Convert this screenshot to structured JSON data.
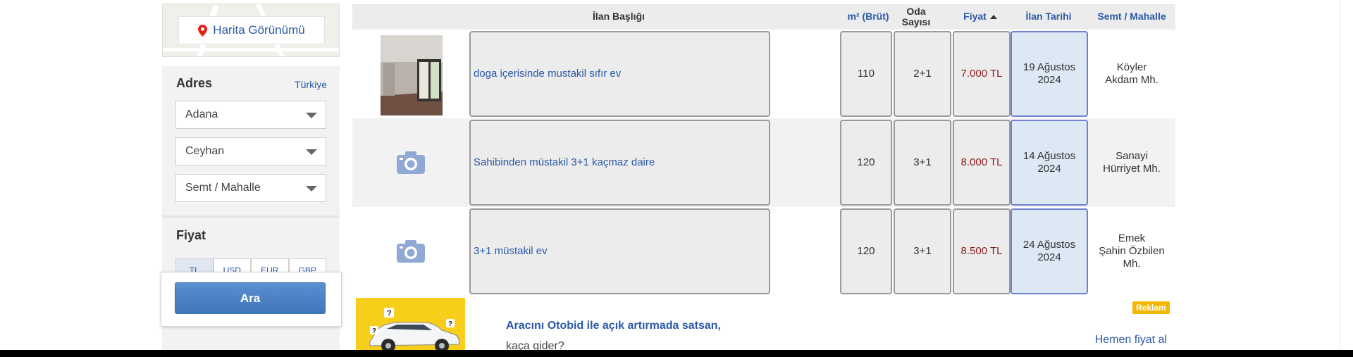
{
  "sidebar": {
    "map_button_label": "Harita Görünümü",
    "address": {
      "title": "Adres",
      "country_link": "Türkiye",
      "province": "Adana",
      "district": "Ceyhan",
      "neighborhood": "Semt / Mahalle"
    },
    "price": {
      "title": "Fiyat",
      "currencies": [
        "TL",
        "USD",
        "EUR",
        "GBP"
      ],
      "selected_currency": "TL"
    },
    "search_button_label": "Ara"
  },
  "table": {
    "headers": {
      "title": "İlan Başlığı",
      "area": "m² (Brüt)",
      "rooms": "Oda Sayısı",
      "price": "Fiyat",
      "date": "İlan Tarihi",
      "location": "Semt / Mahalle"
    },
    "sort": {
      "column": "price",
      "direction": "ascending"
    },
    "rows": [
      {
        "title": "doga içerisinde mustakil sıfır ev",
        "area": "110",
        "rooms": "2+1",
        "price": "7.000 TL",
        "date_day_month": "19 Ağustos",
        "date_year": "2024",
        "loc_line1": "Köyler",
        "loc_line2": "Akdam Mh.",
        "loc_line3": "",
        "has_photo": true
      },
      {
        "title": "Sahibinden müstakil 3+1 kaçmaz daire",
        "area": "120",
        "rooms": "3+1",
        "price": "8.000 TL",
        "date_day_month": "14 Ağustos",
        "date_year": "2024",
        "loc_line1": "Sanayi",
        "loc_line2": "Hürriyet Mh.",
        "loc_line3": "",
        "has_photo": false
      },
      {
        "title": "3+1 müstakil ev",
        "area": "120",
        "rooms": "3+1",
        "price": "8.500 TL",
        "date_day_month": "24 Ağustos",
        "date_year": "2024",
        "loc_line1": "Emek",
        "loc_line2": "Şahin Özbilen",
        "loc_line3": "Mh.",
        "has_photo": false
      }
    ]
  },
  "ad": {
    "title": "Aracını Otobid ile açık artırmada satsan,",
    "subtitle": "kaça gider?",
    "badge": "Reklam",
    "cta": "Hemen fiyat al"
  },
  "icons": {
    "map_pin": "map-pin-icon",
    "dropdown": "chevron-down-icon",
    "no_photo": "camera-icon",
    "sort": "sort-up-icon"
  },
  "colors": {
    "link_blue": "#2a59a6",
    "price_red": "#8b1a1a",
    "date_highlight": "#dce8f3",
    "search_button": "#4a80c4",
    "ad_badge": "#f2b705",
    "ad_yellow": "#f7cf1a"
  }
}
